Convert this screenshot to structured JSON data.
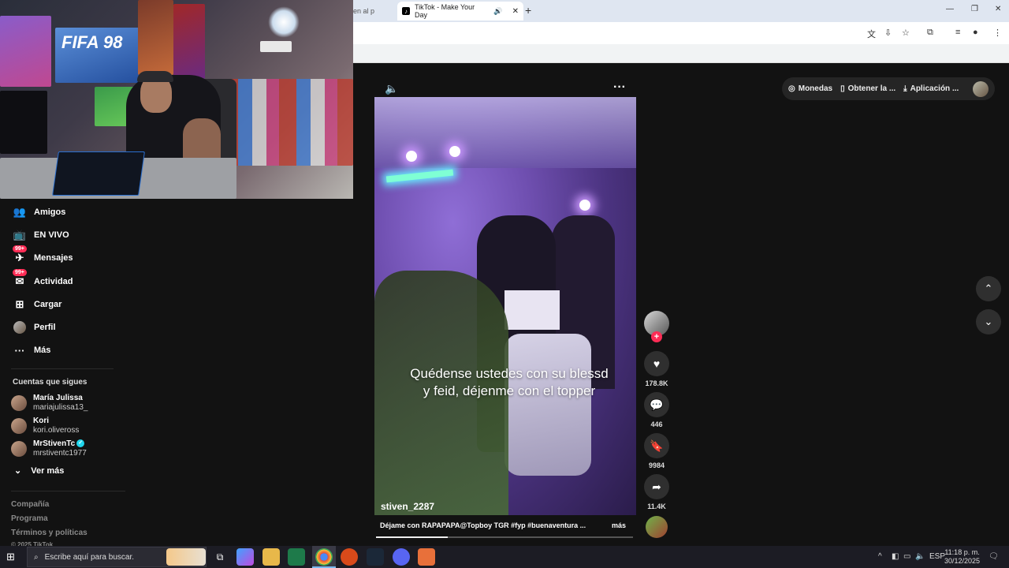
{
  "browser": {
    "prev_tab": "en al p",
    "active_tab": "TikTok - Make Your Day"
  },
  "sidebar": {
    "nav": [
      {
        "label": "Amigos",
        "icon": "friends-icon"
      },
      {
        "label": "EN VIVO",
        "icon": "live-icon"
      },
      {
        "label": "Mensajes",
        "icon": "messages-icon",
        "badge": "99+"
      },
      {
        "label": "Actividad",
        "icon": "activity-icon",
        "badge": "99+"
      },
      {
        "label": "Cargar",
        "icon": "upload-icon"
      },
      {
        "label": "Perfil",
        "icon": "profile-avatar"
      },
      {
        "label": "Más",
        "icon": "more-icon"
      }
    ],
    "following_title": "Cuentas que sigues",
    "following": [
      {
        "name": "María Julissa",
        "handle": "mariajulissa13_"
      },
      {
        "name": "Kori",
        "handle": "kori.oliveross"
      },
      {
        "name": "MrStivenTc",
        "handle": "mrstiventc1977",
        "verified": true
      }
    ],
    "see_more": "Ver más",
    "footer": [
      "Compañía",
      "Programa",
      "Términos y políticas",
      "© 2025 TikTok"
    ]
  },
  "video": {
    "caption_line1": "Quédense ustedes con su blessd",
    "caption_line2": "y feid, déjenme con el topper",
    "username": "stiven_2287",
    "description": "Déjame con RAPAPAPA@Topboy TGR #fyp #buenaventura ...",
    "more": "más",
    "progress": 0.28
  },
  "actions": {
    "likes": "178.8K",
    "comments": "446",
    "saves": "9984",
    "shares": "11.4K"
  },
  "top_pill": {
    "coins": "Monedas",
    "get": "Obtener la ...",
    "app": "Aplicación ..."
  },
  "taskbar": {
    "search_placeholder": "Escribe aquí para buscar.",
    "lang": "ESP",
    "time": "11:18 p. m.",
    "date": "30/12/2025"
  },
  "colors": {
    "accent": "#fe2c55",
    "bg": "#121212"
  }
}
